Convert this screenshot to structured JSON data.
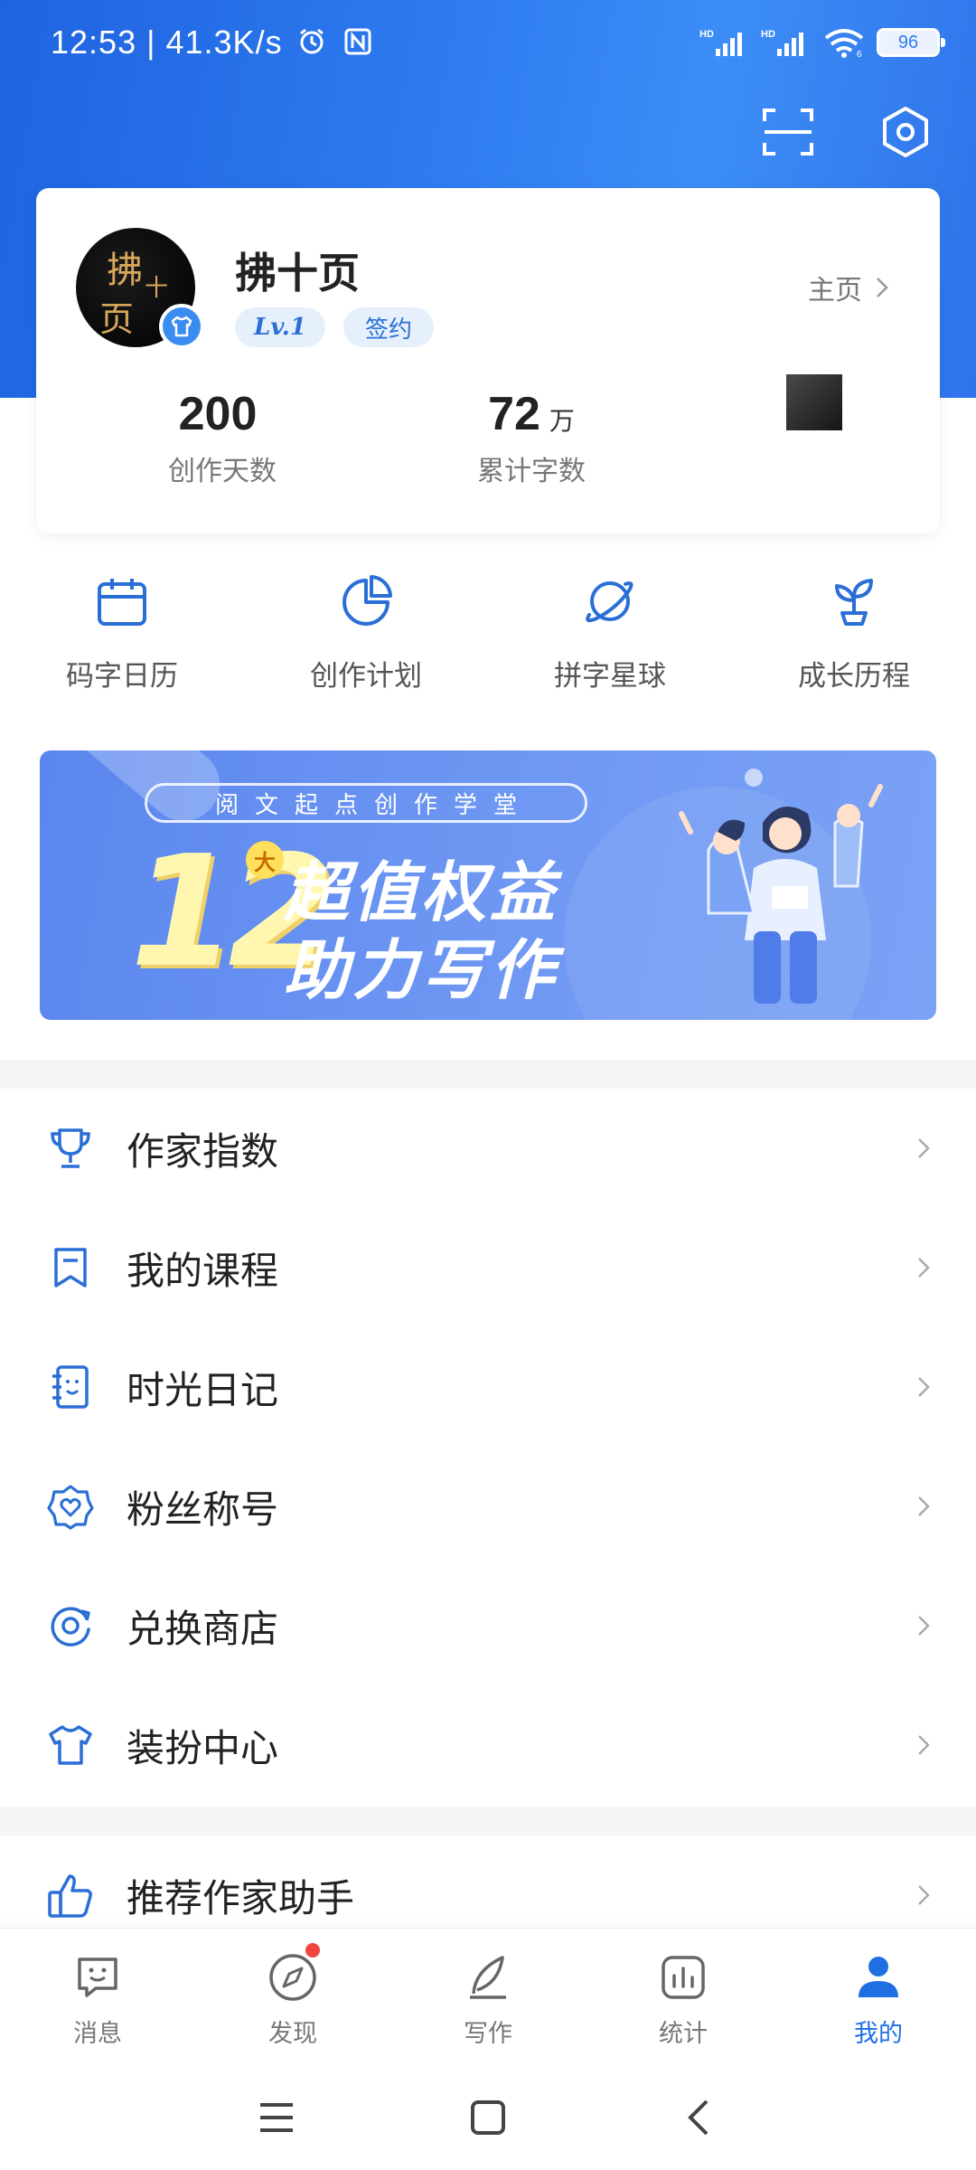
{
  "status_bar": {
    "time": "12:53",
    "separator": "|",
    "speed": "41.3K/s",
    "battery": "96",
    "hd1": "HD",
    "hd2": "HD",
    "wifi_label": "6"
  },
  "colors": {
    "brand": "#2e7cf0",
    "accent": "#1f6fe3",
    "badge_red": "#f0443c"
  },
  "top_actions": [
    {
      "name": "scan",
      "icon": "scan-icon"
    },
    {
      "name": "settings",
      "icon": "settings-hexagon-icon"
    }
  ],
  "profile": {
    "avatar_text": [
      "拂",
      "十",
      "页"
    ],
    "name": "拂十页",
    "level": "Lv.1",
    "tag": "签约",
    "homepage_label": "主页",
    "stats": [
      {
        "value": "200",
        "unit": "",
        "label": "创作天数"
      },
      {
        "value": "72",
        "unit": "万",
        "label": "累计字数"
      }
    ]
  },
  "shortcuts": [
    {
      "label": "码字日历",
      "icon": "calendar-icon"
    },
    {
      "label": "创作计划",
      "icon": "pie-chart-icon"
    },
    {
      "label": "拼字星球",
      "icon": "planet-icon"
    },
    {
      "label": "成长历程",
      "icon": "sprout-icon"
    }
  ],
  "banner": {
    "subtitle": "阅文起点创作学堂",
    "big_number": "12",
    "badge": "大",
    "line1": "超值权益",
    "line2": "助力写作"
  },
  "menu": [
    {
      "label": "作家指数",
      "icon": "trophy-icon"
    },
    {
      "label": "我的课程",
      "icon": "bookmark-icon"
    },
    {
      "label": "时光日记",
      "icon": "diary-icon"
    },
    {
      "label": "粉丝称号",
      "icon": "heart-badge-icon"
    },
    {
      "label": "兑换商店",
      "icon": "exchange-icon"
    },
    {
      "label": "装扮中心",
      "icon": "shirt-icon"
    }
  ],
  "recommend": {
    "label": "推荐作家助手",
    "icon": "thumbs-up-icon"
  },
  "bottom_nav": [
    {
      "label": "消息",
      "icon": "message-icon",
      "active": false,
      "dot": false
    },
    {
      "label": "发现",
      "icon": "compass-icon",
      "active": false,
      "dot": true
    },
    {
      "label": "写作",
      "icon": "pen-icon",
      "active": false,
      "dot": false
    },
    {
      "label": "统计",
      "icon": "stats-icon",
      "active": false,
      "dot": false
    },
    {
      "label": "我的",
      "icon": "user-icon",
      "active": true,
      "dot": false
    }
  ],
  "system_nav": [
    "menu-icon",
    "home-square-icon",
    "back-icon"
  ]
}
